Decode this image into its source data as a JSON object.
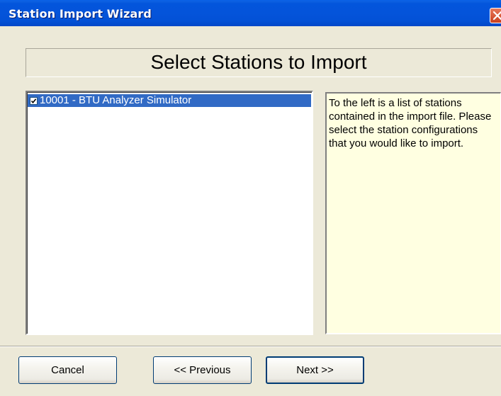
{
  "window": {
    "title": "Station Import Wizard"
  },
  "heading": "Select Stations to Import",
  "stations": {
    "items": [
      {
        "label": "10001 - BTU Analyzer Simulator",
        "checked": true,
        "selected": true
      }
    ]
  },
  "info": {
    "text": "To the left is a list of stations contained in the import file. Please select the station configurations that you would like to import."
  },
  "buttons": {
    "cancel": "Cancel",
    "previous": "<< Previous",
    "next": "Next >>"
  },
  "colors": {
    "titlebar": "#0454DA",
    "selection": "#316AC5",
    "info_background": "#FFFFE1",
    "window_background": "#ECE9D8"
  }
}
